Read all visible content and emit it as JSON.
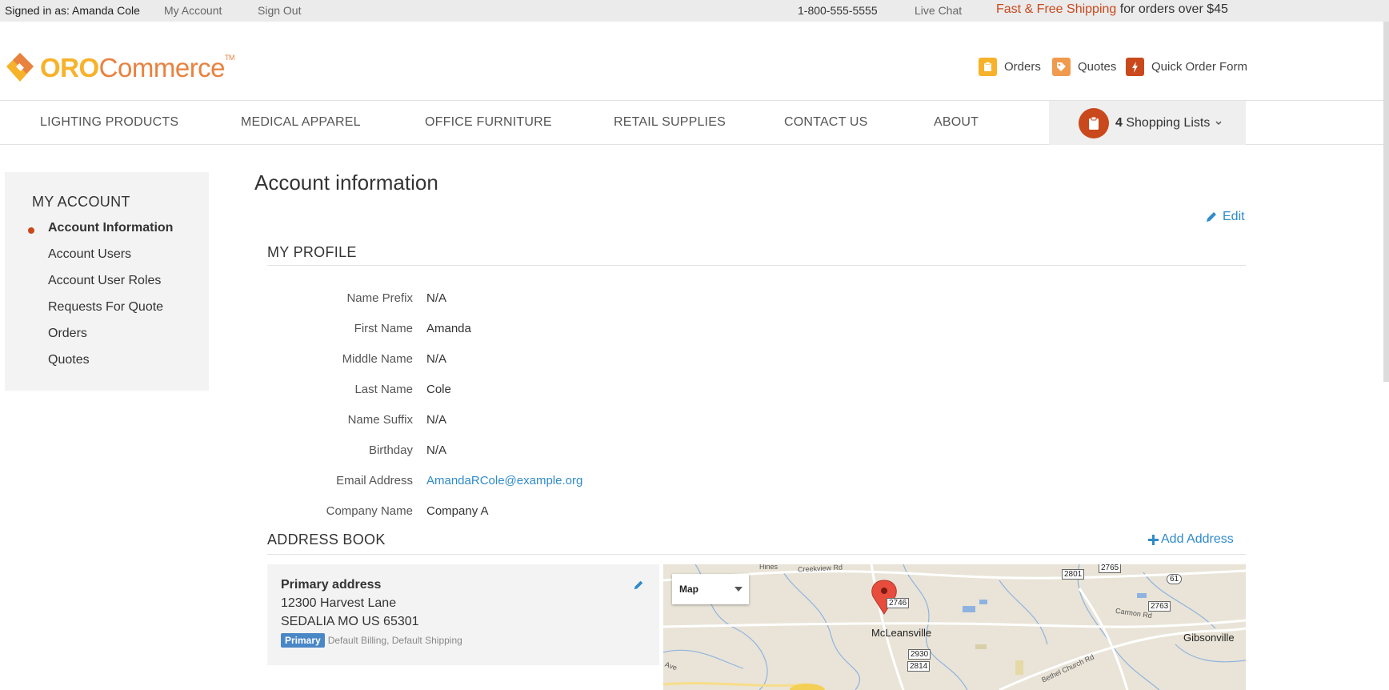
{
  "topbar": {
    "signed_in": "Signed in as: Amanda Cole",
    "my_account": "My Account",
    "sign_out": "Sign Out",
    "phone": "1-800-555-5555",
    "live_chat": "Live Chat",
    "shipping_accent": "Fast & Free Shipping",
    "shipping_rest": " for orders over $45"
  },
  "logo": {
    "part1": "ORO",
    "part2": "Commerce",
    "tm": "TM"
  },
  "quick_links": {
    "orders": "Orders",
    "quotes": "Quotes",
    "quick_order": "Quick Order Form"
  },
  "nav": {
    "items": [
      "LIGHTING PRODUCTS",
      "MEDICAL APPAREL",
      "OFFICE FURNITURE",
      "RETAIL SUPPLIES",
      "CONTACT US",
      "ABOUT"
    ],
    "shopping_count": "4",
    "shopping_label": " Shopping Lists"
  },
  "sidebar": {
    "title": "MY ACCOUNT",
    "items": [
      "Account Information",
      "Account Users",
      "Account User Roles",
      "Requests For Quote",
      "Orders",
      "Quotes"
    ]
  },
  "page": {
    "title": "Account information",
    "edit": "Edit"
  },
  "profile": {
    "title": "MY PROFILE",
    "rows": [
      {
        "label": "Name Prefix",
        "value": "N/A"
      },
      {
        "label": "First Name",
        "value": "Amanda"
      },
      {
        "label": "Middle Name",
        "value": "N/A"
      },
      {
        "label": "Last Name",
        "value": "Cole"
      },
      {
        "label": "Name Suffix",
        "value": "N/A"
      },
      {
        "label": "Birthday",
        "value": "N/A"
      },
      {
        "label": "Email Address",
        "value": "AmandaRCole@example.org"
      },
      {
        "label": "Company Name",
        "value": "Company A"
      }
    ]
  },
  "address_book": {
    "title": "ADDRESS BOOK",
    "add": "Add Address",
    "card": {
      "title": "Primary address",
      "line1": "12300 Harvest Lane",
      "line2": "SEDALIA MO US 65301",
      "badge": "Primary",
      "types": "Default Billing, Default Shipping"
    },
    "map": {
      "type_selected": "Map",
      "place_main": "McLeansville",
      "place_east": "Gibsonville",
      "roads": [
        "Creekview Rd",
        "Carmon Rd",
        "Bethel Church Rd",
        "Hines",
        "Ave"
      ],
      "shields": [
        "2801",
        "2765",
        "61",
        "2746",
        "2763",
        "2930",
        "2814"
      ]
    }
  },
  "colors": {
    "accent": "#c9491c",
    "link": "#2f8bc9",
    "gold": "#f6b22a",
    "orange": "#e8823f"
  }
}
